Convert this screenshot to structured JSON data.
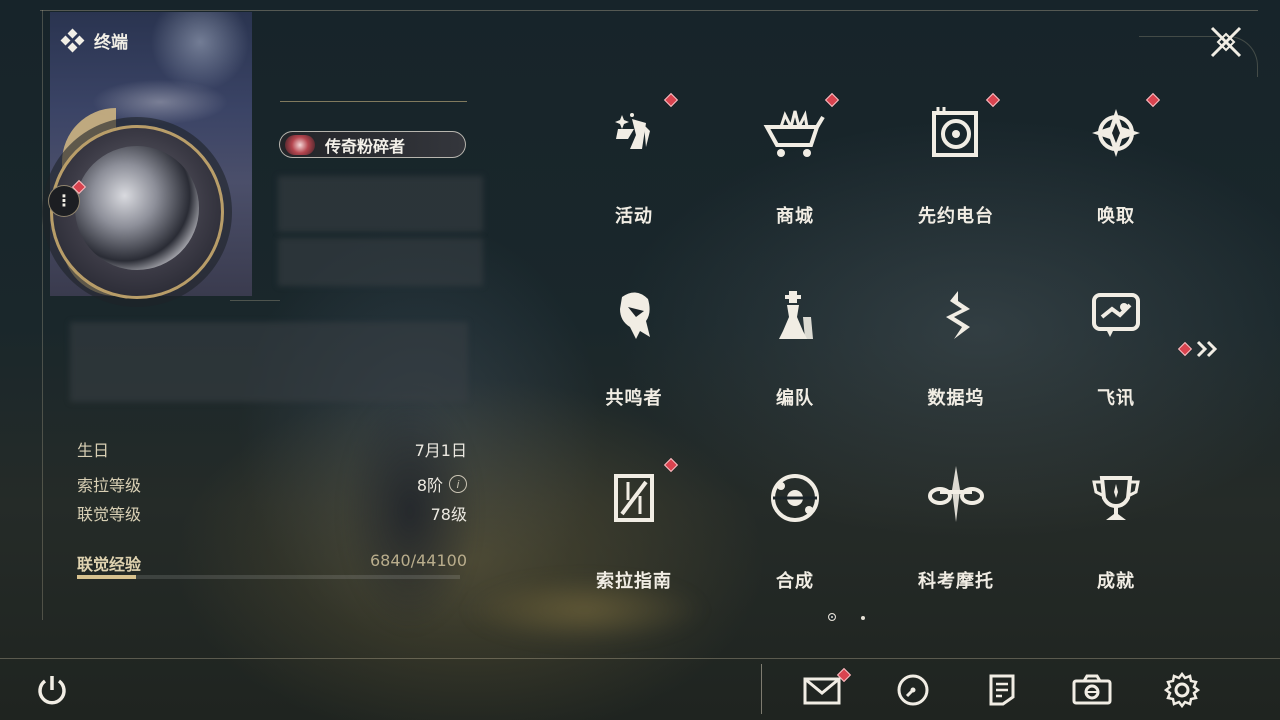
{
  "terminal": {
    "title": "终端"
  },
  "profile": {
    "title_badge": "传奇粉碎者",
    "stats": [
      {
        "label": "生日",
        "value": "7月1日"
      },
      {
        "label": "索拉等级",
        "value": "8阶"
      },
      {
        "label": "联觉等级",
        "value": "78级"
      }
    ],
    "experience": {
      "label": "联觉经验",
      "value": "6840/44100",
      "current": 6840,
      "max": 44100
    }
  },
  "menu": {
    "items": [
      {
        "label": "活动",
        "icon": "activity-icon",
        "badge": true
      },
      {
        "label": "商城",
        "icon": "shop-cart-icon",
        "badge": true
      },
      {
        "label": "先约电台",
        "icon": "radio-icon",
        "badge": true
      },
      {
        "label": "唤取",
        "icon": "summon-icon",
        "badge": true
      },
      {
        "label": "共鸣者",
        "icon": "resonator-icon",
        "badge": false
      },
      {
        "label": "编队",
        "icon": "team-chess-icon",
        "badge": false
      },
      {
        "label": "数据坞",
        "icon": "data-bank-icon",
        "badge": false
      },
      {
        "label": "飞讯",
        "icon": "message-icon",
        "badge": false
      },
      {
        "label": "索拉指南",
        "icon": "guide-icon",
        "badge": true
      },
      {
        "label": "合成",
        "icon": "synthesis-icon",
        "badge": false
      },
      {
        "label": "科考摩托",
        "icon": "motorcycle-icon",
        "badge": false
      },
      {
        "label": "成就",
        "icon": "trophy-icon",
        "badge": false
      }
    ],
    "pagination": {
      "current": 1,
      "total": 2
    }
  },
  "bottom_bar": {
    "icons": [
      "power-icon",
      "mail-icon",
      "clock-icon",
      "notes-icon",
      "camera-icon",
      "settings-gear-icon"
    ]
  },
  "colors": {
    "accent": "#d8c28f",
    "badge_red": "#d9434f",
    "text": "#f1ede4"
  }
}
